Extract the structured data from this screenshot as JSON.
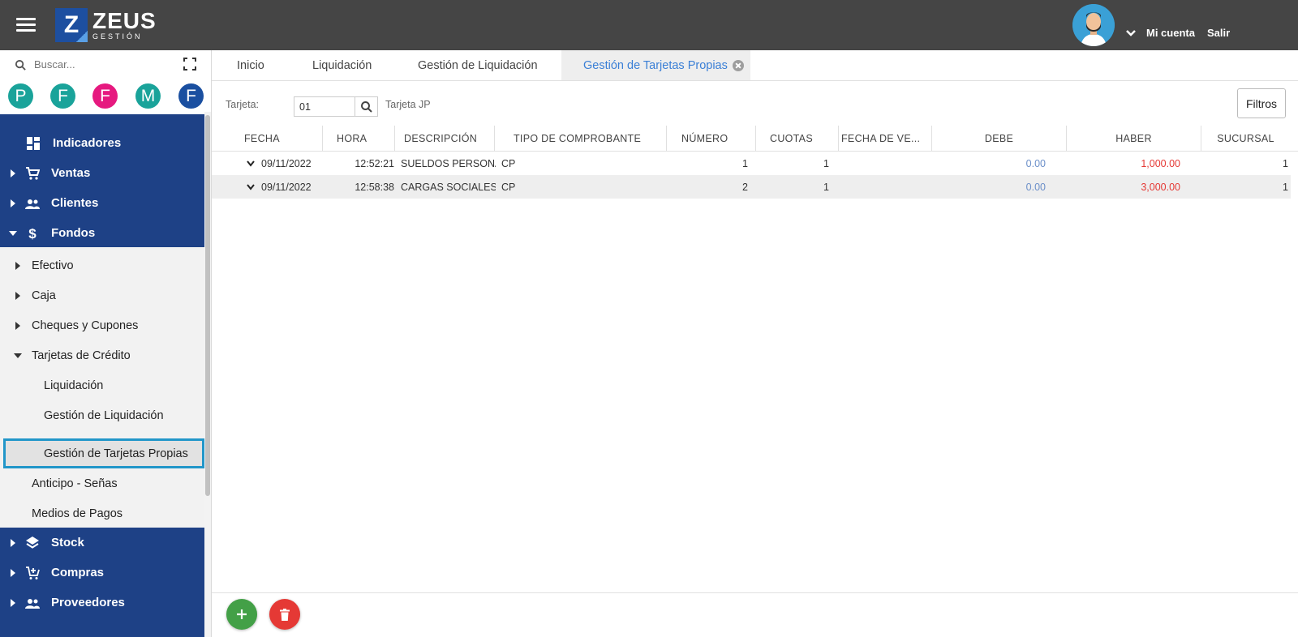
{
  "app": {
    "logo_letter": "Z",
    "logo_name": "ZEUS",
    "logo_sub": "GESTIÓN"
  },
  "header": {
    "account_label": "Mi cuenta",
    "logout_label": "Salir"
  },
  "sidebar": {
    "search_placeholder": "Buscar...",
    "favorites": [
      {
        "letter": "P",
        "color": "#1aa39a"
      },
      {
        "letter": "F",
        "color": "#1aa39a"
      },
      {
        "letter": "F",
        "color": "#e6197f"
      },
      {
        "letter": "M",
        "color": "#1aa39a"
      },
      {
        "letter": "F",
        "color": "#1a4fa0"
      }
    ],
    "top_items": [
      {
        "label": "Indicadores",
        "icon": "dashboard-icon"
      },
      {
        "label": "Ventas",
        "icon": "cart-icon"
      },
      {
        "label": "Clientes",
        "icon": "people-icon"
      },
      {
        "label": "Fondos",
        "icon": "dollar-icon",
        "expanded": true
      }
    ],
    "fondos_items": [
      {
        "label": "Efectivo"
      },
      {
        "label": "Caja"
      },
      {
        "label": "Cheques y Cupones"
      },
      {
        "label": "Tarjetas de Crédito",
        "expanded": true
      },
      {
        "label": "Liquidación"
      },
      {
        "label": "Gestión de Liquidación"
      },
      {
        "label": "Gestión de Tarjetas Propias",
        "active": true
      },
      {
        "label": "Anticipo - Señas"
      },
      {
        "label": "Medios de Pagos"
      }
    ],
    "bottom_items": [
      {
        "label": "Stock",
        "icon": "layers-icon"
      },
      {
        "label": "Compras",
        "icon": "cart-add-icon"
      },
      {
        "label": "Proveedores",
        "icon": "people-icon"
      }
    ]
  },
  "tabs": [
    {
      "label": "Inicio"
    },
    {
      "label": "Liquidación"
    },
    {
      "label": "Gestión de Liquidación"
    },
    {
      "label": "Gestión de Tarjetas Propias",
      "active": true
    }
  ],
  "filter": {
    "tarjeta_label": "Tarjeta:",
    "tarjeta_value": "01",
    "tarjeta_name": "Tarjeta JP",
    "filters_button": "Filtros"
  },
  "table": {
    "columns": [
      "FECHA",
      "HORA",
      "DESCRIPCIÓN",
      "TIPO DE COMPROBANTE",
      "NÚMERO",
      "CUOTAS",
      "FECHA DE VE...",
      "DEBE",
      "HABER",
      "SUCURSAL"
    ],
    "rows": [
      {
        "fecha": "09/11/2022",
        "hora": "12:52:21",
        "descripcion": "SUELDOS PERSONAL",
        "tipo": "CP",
        "numero": "1",
        "cuotas": "1",
        "vencimiento": "",
        "debe": "0.00",
        "haber": "1,000.00",
        "sucursal": "1"
      },
      {
        "fecha": "09/11/2022",
        "hora": "12:58:38",
        "descripcion": "CARGAS SOCIALES P",
        "tipo": "CP",
        "numero": "2",
        "cuotas": "1",
        "vencimiento": "",
        "debe": "0.00",
        "haber": "3,000.00",
        "sucursal": "1"
      }
    ]
  },
  "colors": {
    "header_bg": "#454545",
    "menu_blue": "#1e4186",
    "active_tab_text": "#3a7fd6",
    "add_button": "#43a047",
    "delete_button": "#e53935"
  }
}
